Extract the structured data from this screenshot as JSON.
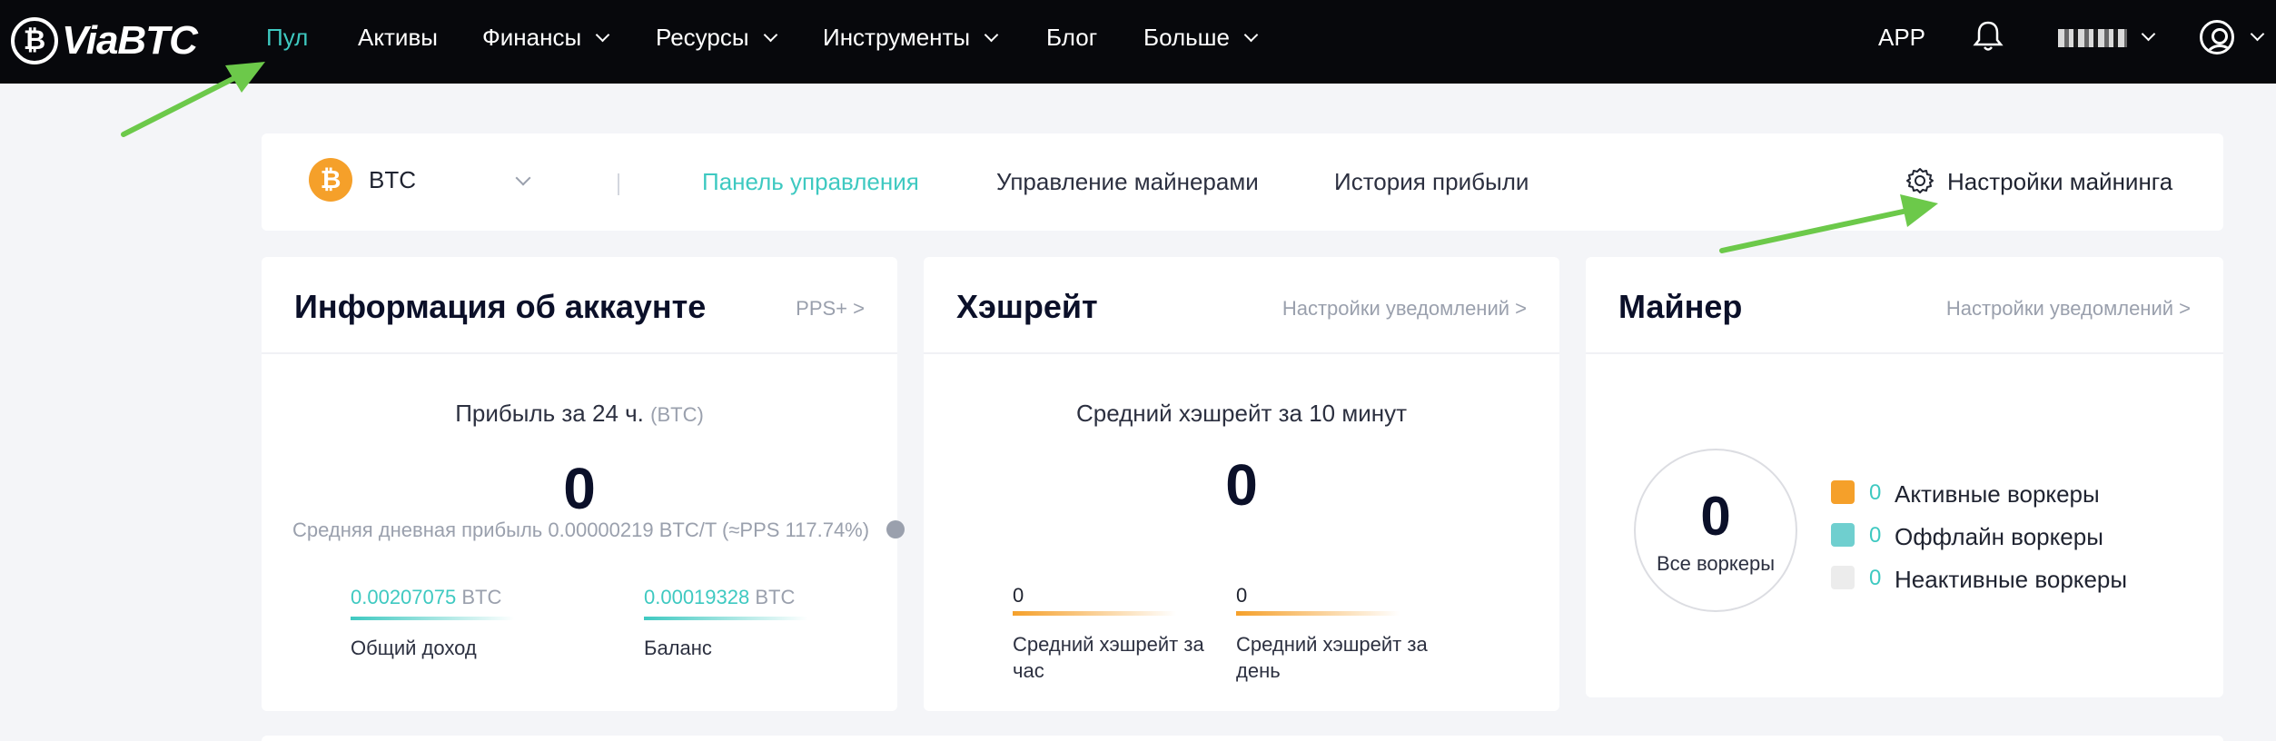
{
  "nav": {
    "logo_text": "ViaBTC",
    "items": [
      {
        "label": "Пул",
        "active": true,
        "dropdown": false
      },
      {
        "label": "Активы",
        "active": false,
        "dropdown": false
      },
      {
        "label": "Финансы",
        "active": false,
        "dropdown": true
      },
      {
        "label": "Ресурсы",
        "active": false,
        "dropdown": true
      },
      {
        "label": "Инструменты",
        "active": false,
        "dropdown": true
      },
      {
        "label": "Блог",
        "active": false,
        "dropdown": false
      },
      {
        "label": "Больше",
        "active": false,
        "dropdown": true
      }
    ],
    "app_label": "APP",
    "icons": [
      "bell-icon",
      "user-icon"
    ]
  },
  "subbar": {
    "coin": "BTC",
    "coin_icon": "bitcoin-icon",
    "tabs": [
      {
        "label": "Панель управления",
        "active": true
      },
      {
        "label": "Управление майнерами",
        "active": false
      },
      {
        "label": "История прибыли",
        "active": false
      }
    ],
    "settings_label": "Настройки майнинга"
  },
  "account": {
    "title": "Информация об аккаунте",
    "link": "PPS+ >",
    "profit_label": "Прибыль за 24 ч.",
    "profit_unit": "(BTC)",
    "profit_value": "0",
    "avg_profit": "Средняя дневная прибыль 0.00000219 BTC/T (≈PPS 117.74%)",
    "total_income_value": "0.00207075",
    "total_income_unit": "BTC",
    "total_income_label": "Общий доход",
    "balance_value": "0.00019328",
    "balance_unit": "BTC",
    "balance_label": "Баланс"
  },
  "hashrate": {
    "title": "Хэшрейт",
    "link": "Настройки уведомлений >",
    "avg10_label": "Средний хэшрейт за 10 минут",
    "avg10_value": "0",
    "hour_value": "0",
    "hour_label": "Средний хэшрейт за час",
    "day_value": "0",
    "day_label": "Средний хэшрейт за день"
  },
  "miner": {
    "title": "Майнер",
    "link": "Настройки уведомлений >",
    "total": "0",
    "total_label": "Все воркеры",
    "legend": [
      {
        "count": "0",
        "label": "Активные воркеры",
        "color": "#f5a02a"
      },
      {
        "count": "0",
        "label": "Оффлайн воркеры",
        "color": "#6fcfcf"
      },
      {
        "count": "0",
        "label": "Неактивные воркеры",
        "color": "#ececec"
      }
    ]
  },
  "colors": {
    "accent": "#3ec9c1",
    "nav_bg": "#07080c",
    "annotation_arrow": "#6cc94a"
  }
}
